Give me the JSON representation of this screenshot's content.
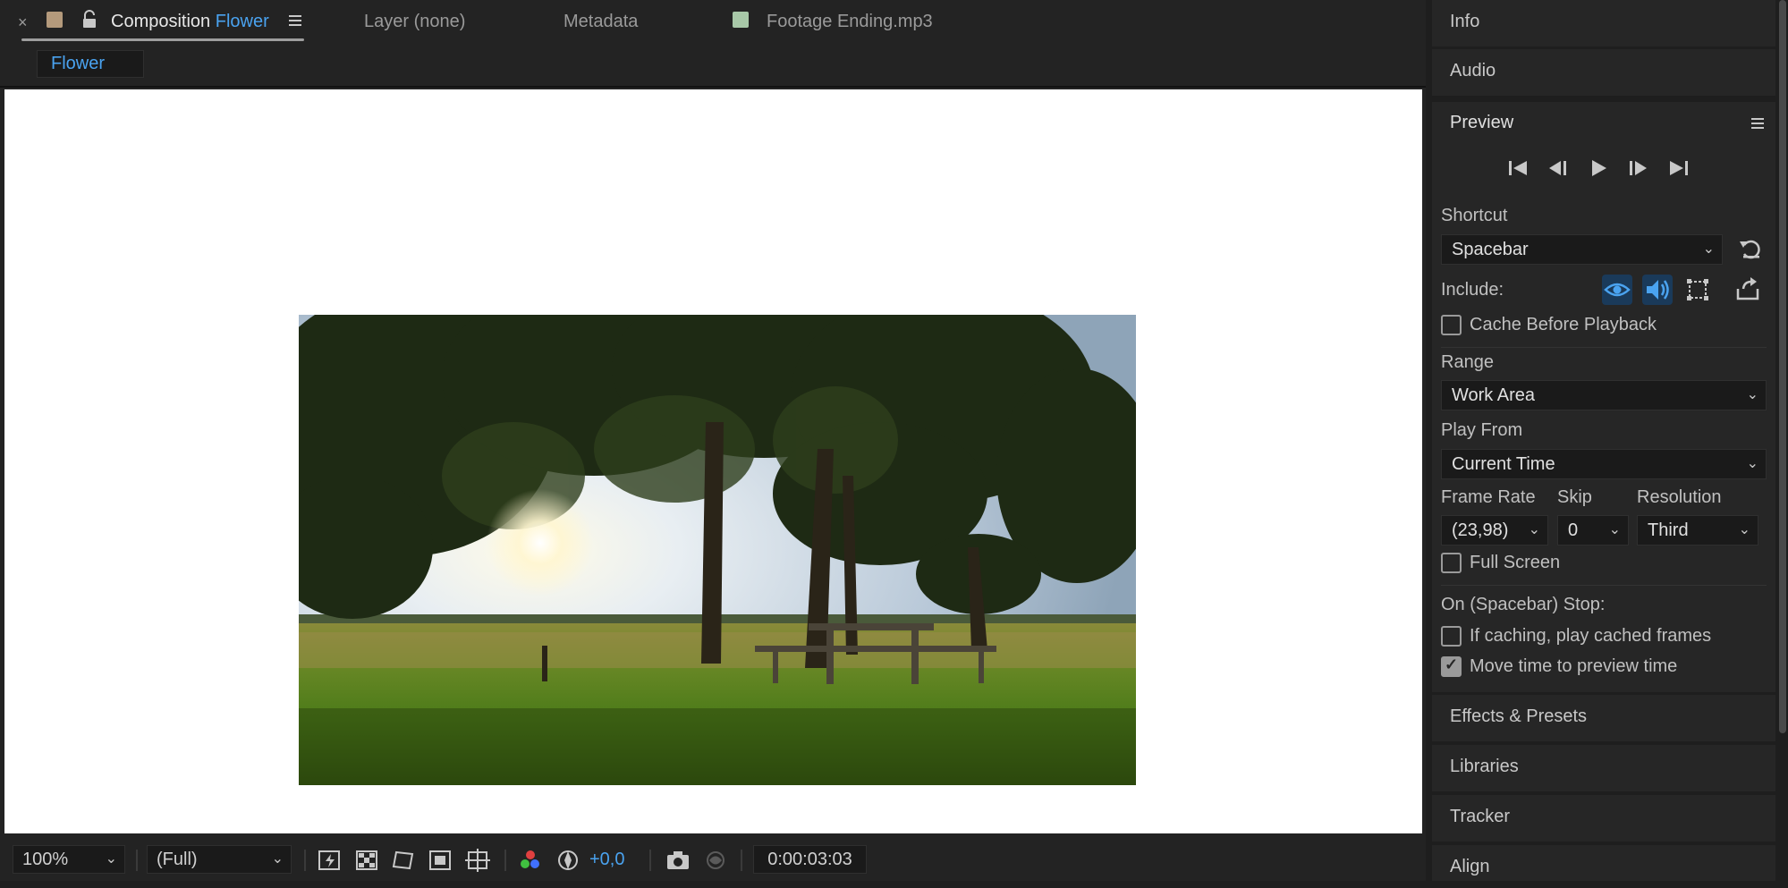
{
  "tabs": {
    "close_glyph": "×",
    "composition_prefix": "Composition",
    "composition_name": "Flower",
    "layer": "Layer (none)",
    "metadata": "Metadata",
    "footage": "Footage Ending.mp3"
  },
  "breadcrumb": "Flower",
  "viewer_toolbar": {
    "zoom": "100%",
    "resolution": "(Full)",
    "exposure": "+0,0",
    "timecode": "0:00:03:03"
  },
  "panels": {
    "info": "Info",
    "audio": "Audio",
    "preview": "Preview",
    "effects": "Effects & Presets",
    "libraries": "Libraries",
    "tracker": "Tracker",
    "align": "Align"
  },
  "preview": {
    "shortcut_label": "Shortcut",
    "shortcut_value": "Spacebar",
    "include_label": "Include:",
    "cache_before_playback": {
      "label": "Cache Before Playback",
      "checked": false
    },
    "range_label": "Range",
    "range_value": "Work Area",
    "play_from_label": "Play From",
    "play_from_value": "Current Time",
    "frame_rate_label": "Frame Rate",
    "frame_rate_value": "(23,98)",
    "skip_label": "Skip",
    "skip_value": "0",
    "resolution_label": "Resolution",
    "resolution_value": "Third",
    "full_screen": {
      "label": "Full Screen",
      "checked": false
    },
    "on_stop_label": "On (Spacebar) Stop:",
    "if_caching": {
      "label": "If caching, play cached frames",
      "checked": false
    },
    "move_time": {
      "label": "Move time to preview time",
      "checked": true
    }
  },
  "colors": {
    "accent": "#4aa3f0",
    "comp_swatch": "#b49a7c",
    "footage_swatch": "#a8c8a8"
  }
}
